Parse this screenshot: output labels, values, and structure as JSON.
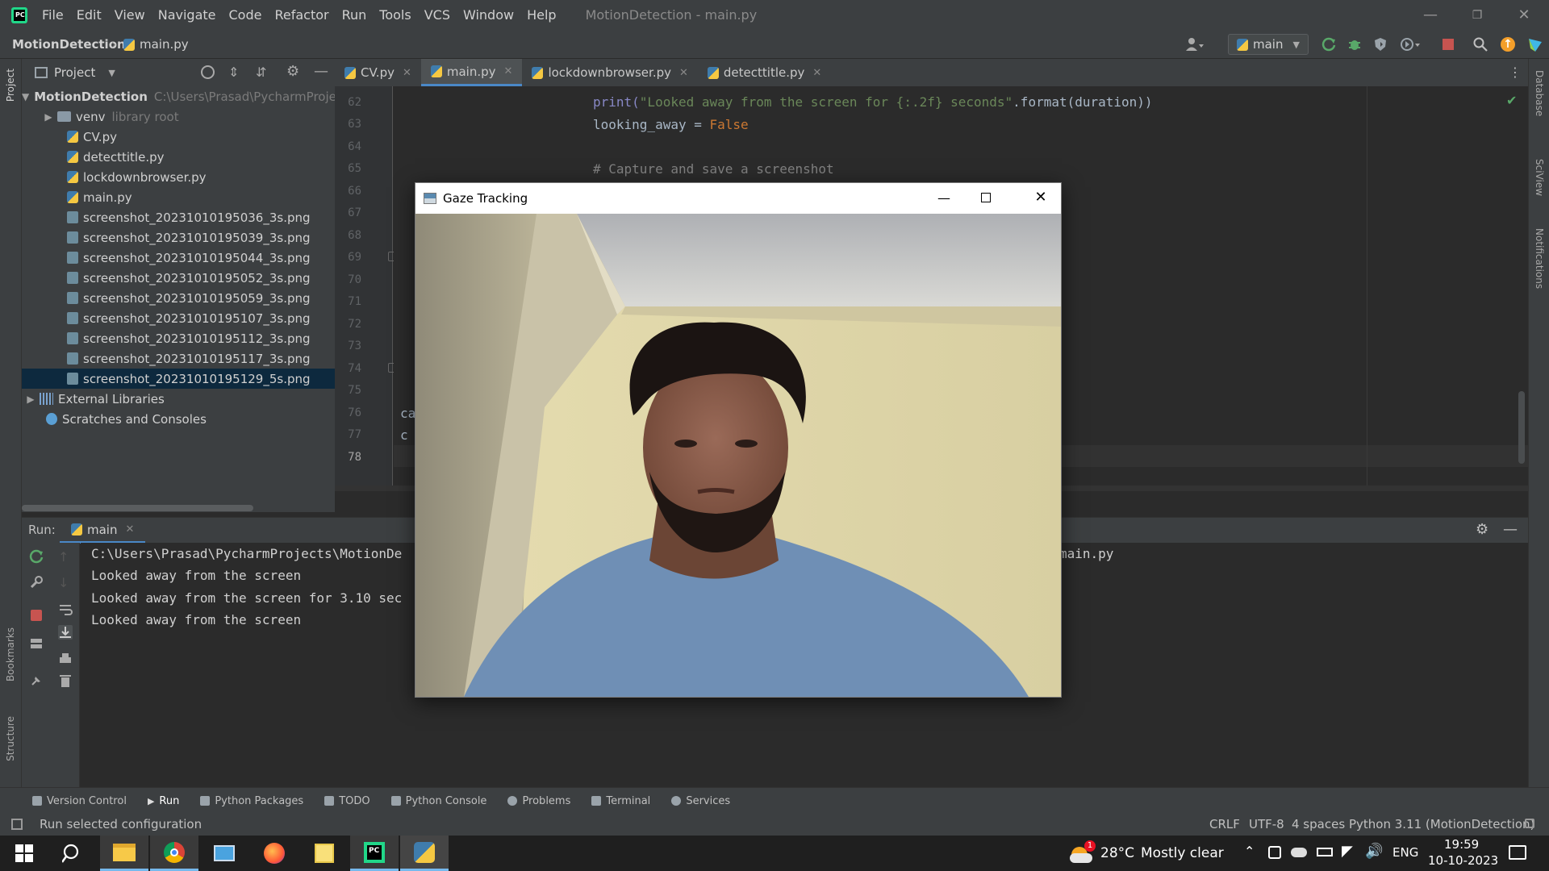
{
  "window": {
    "menu": [
      "File",
      "Edit",
      "View",
      "Navigate",
      "Code",
      "Refactor",
      "Run",
      "Tools",
      "VCS",
      "Window",
      "Help"
    ],
    "title": "MotionDetection - main.py"
  },
  "nav": {
    "project": "MotionDetection",
    "file": "main.py",
    "branch": "main"
  },
  "project_panel": {
    "title": "Project",
    "root_name": "MotionDetection",
    "root_path": "C:\\Users\\Prasad\\PycharmProjec",
    "items": [
      {
        "name": "venv",
        "note": "library root"
      },
      {
        "name": "CV.py"
      },
      {
        "name": "detecttitle.py"
      },
      {
        "name": "lockdownbrowser.py"
      },
      {
        "name": "main.py"
      },
      {
        "name": "screenshot_20231010195036_3s.png"
      },
      {
        "name": "screenshot_20231010195039_3s.png"
      },
      {
        "name": "screenshot_20231010195044_3s.png"
      },
      {
        "name": "screenshot_20231010195052_3s.png"
      },
      {
        "name": "screenshot_20231010195059_3s.png"
      },
      {
        "name": "screenshot_20231010195107_3s.png"
      },
      {
        "name": "screenshot_20231010195112_3s.png"
      },
      {
        "name": "screenshot_20231010195117_3s.png"
      },
      {
        "name": "screenshot_20231010195129_5s.png"
      }
    ],
    "external": "External Libraries",
    "scratches": "Scratches and Consoles"
  },
  "tabs": [
    "CV.py",
    "main.py",
    "lockdownbrowser.py",
    "detecttitle.py"
  ],
  "editor": {
    "line_numbers": [
      "62",
      "63",
      "64",
      "65",
      "66",
      "67",
      "68",
      "69",
      "70",
      "71",
      "72",
      "73",
      "74",
      "75",
      "76",
      "77",
      "78"
    ],
    "line62_a": "print(",
    "line62_b": "\"Looked away from the screen for {:.2f} seconds\"",
    "line62_c": ".format(duration))",
    "line63_a": "looking_away = ",
    "line63_b": "False",
    "line65": "# Capture and save a screenshot",
    "line76": "ca",
    "line77": "c"
  },
  "run_panel": {
    "label": "Run:",
    "config": "main",
    "lines": [
      "C:\\Users\\Prasad\\PycharmProjects\\MotionDe",
      "Looked away from the screen",
      "Looked away from the screen for 3.10 sec",
      "Looked away from the screen"
    ],
    "line1_tail": "main.py"
  },
  "gaze_window": {
    "title": "Gaze Tracking"
  },
  "bottom_tools": [
    "Version Control",
    "Run",
    "Python Packages",
    "TODO",
    "Python Console",
    "Problems",
    "Terminal",
    "Services"
  ],
  "status": {
    "message": "Run selected configuration",
    "line_sep": "CRLF",
    "encoding": "UTF-8",
    "indent": "4 spaces",
    "interpreter": "Python 3.11 (MotionDetection)"
  },
  "side_labels": {
    "project": "Project",
    "bookmarks": "Bookmarks",
    "structure": "Structure",
    "database": "Database",
    "sciview": "SciView",
    "notifications": "Notifications"
  },
  "taskbar": {
    "weather_badge": "1",
    "temperature": "28°C",
    "weather": "Mostly clear",
    "language": "ENG",
    "time": "19:59",
    "date": "10-10-2023"
  }
}
